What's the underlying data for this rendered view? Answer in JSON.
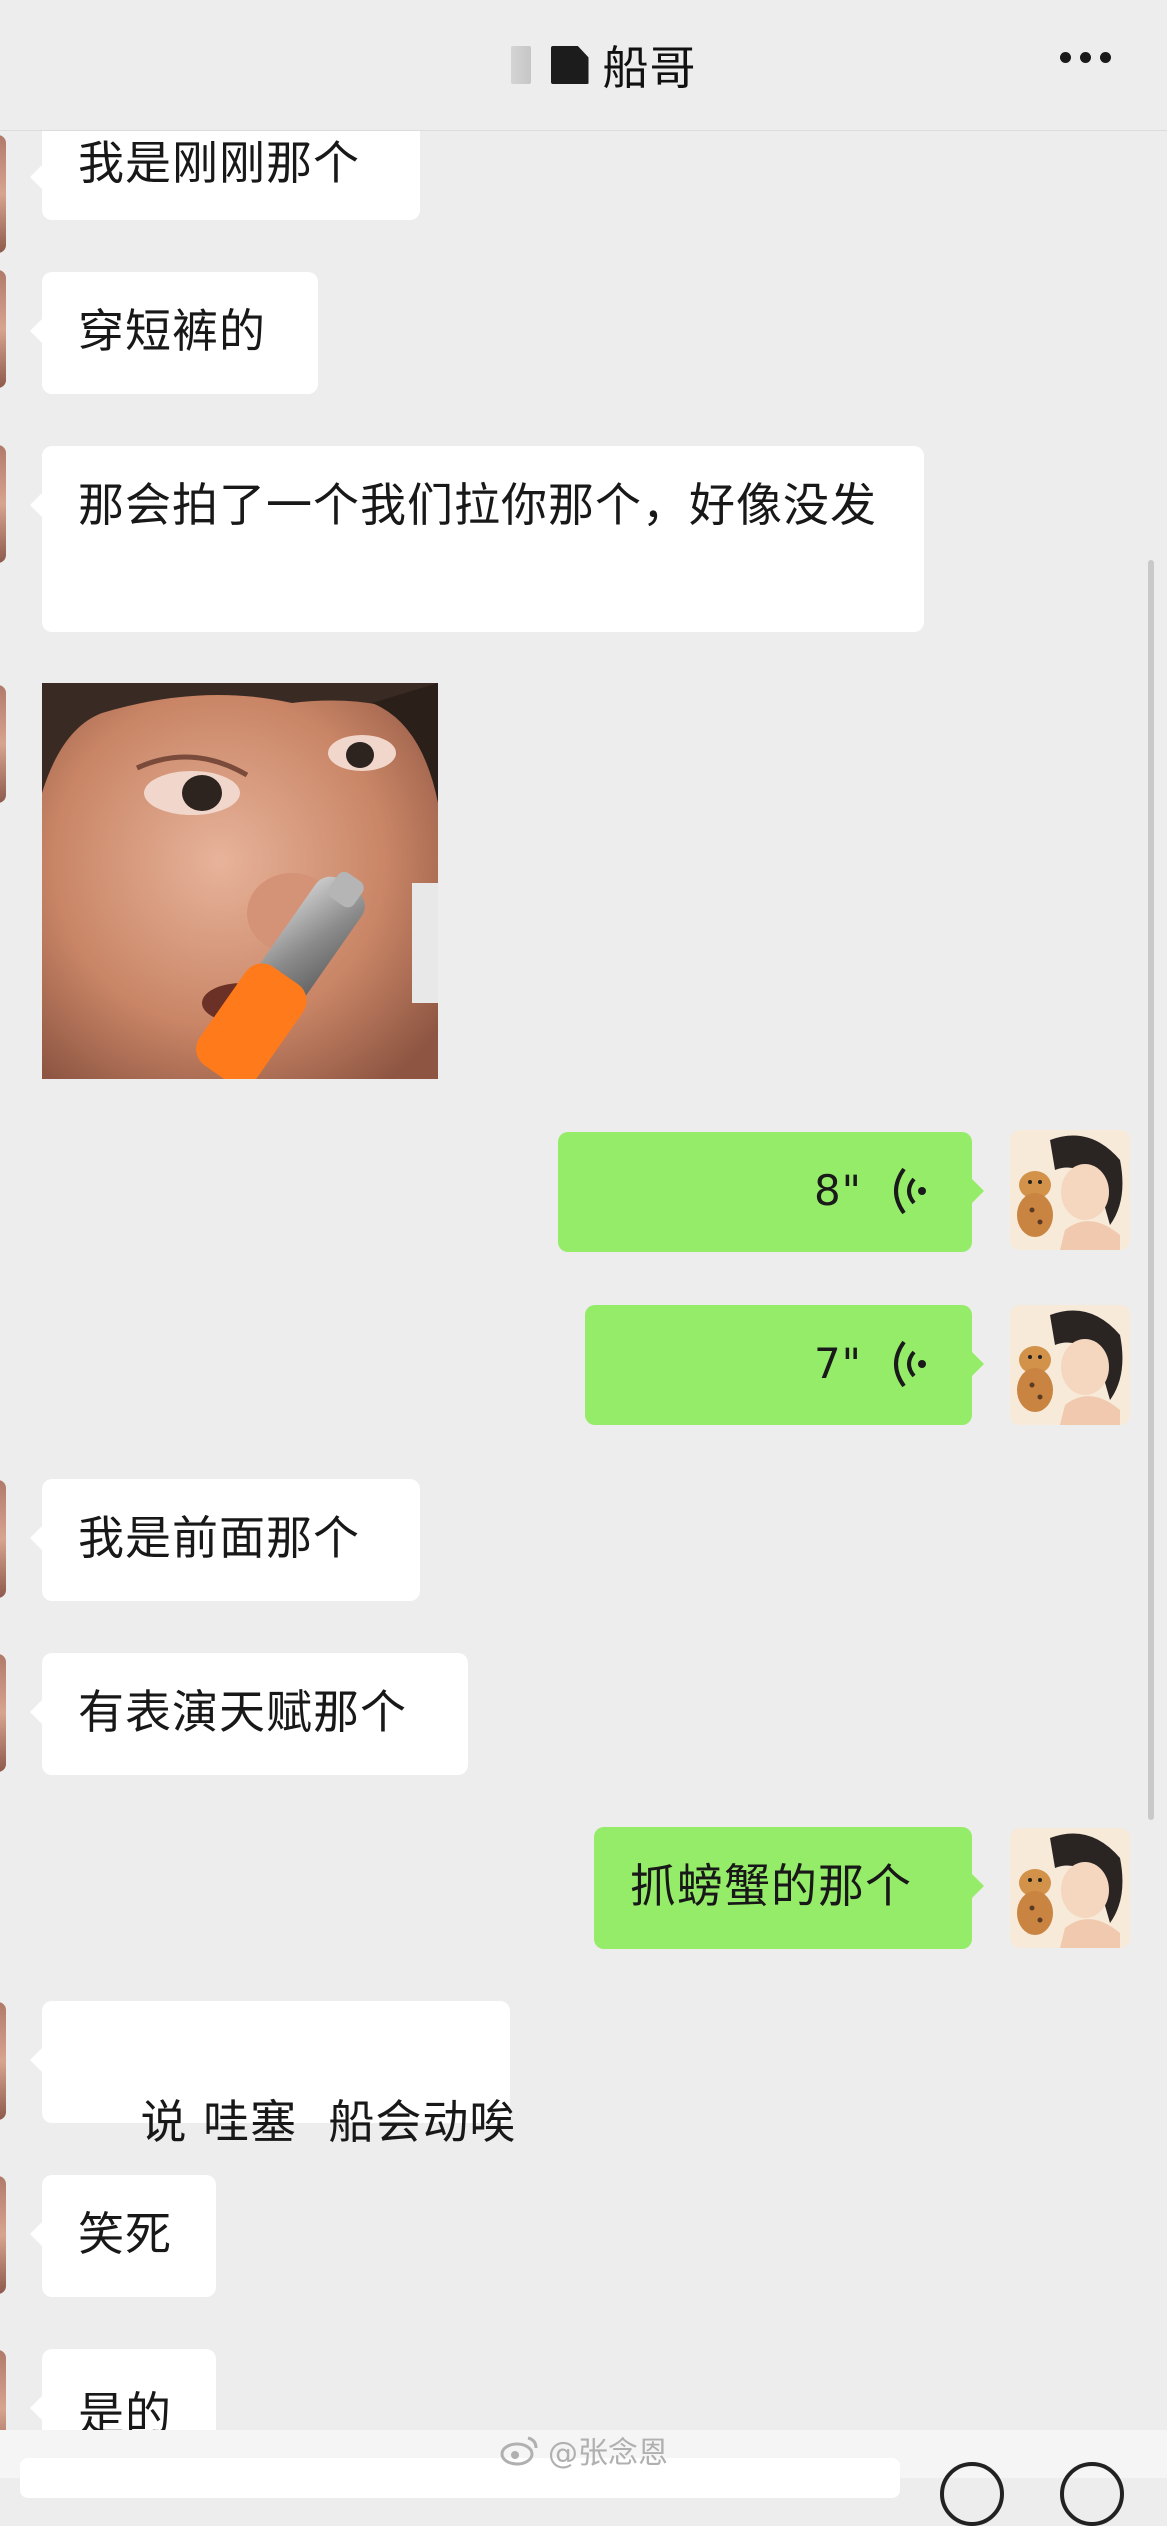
{
  "header": {
    "title": "船哥",
    "more_icon": "more-icon"
  },
  "messages": [
    {
      "side": "left",
      "type": "text",
      "text": "我是刚刚那个"
    },
    {
      "side": "left",
      "type": "text",
      "text": "穿短裤的"
    },
    {
      "side": "left",
      "type": "text",
      "text": "那会拍了一个我们拉你那个，好像没发"
    },
    {
      "side": "left",
      "type": "image",
      "alt": "child-with-nose-aspirator-sticker"
    },
    {
      "side": "right",
      "type": "voice",
      "duration": "8\""
    },
    {
      "side": "right",
      "type": "voice",
      "duration": "7\""
    },
    {
      "side": "left",
      "type": "text",
      "text": "我是前面那个"
    },
    {
      "side": "left",
      "type": "text",
      "text": "有表演天赋那个"
    },
    {
      "side": "right",
      "type": "text",
      "text": "抓螃蟹的那个"
    },
    {
      "side": "left",
      "type": "text",
      "text": "说 哇塞  船会动唉"
    },
    {
      "side": "left",
      "type": "text",
      "text": "笑死"
    },
    {
      "side": "left",
      "type": "text",
      "text": "是的"
    }
  ],
  "watermark": {
    "text": "@张念恩",
    "icon": "weibo-icon"
  },
  "colors": {
    "background": "#ededed",
    "left_bubble": "#ffffff",
    "right_bubble": "#95ec69",
    "text": "#181818"
  }
}
